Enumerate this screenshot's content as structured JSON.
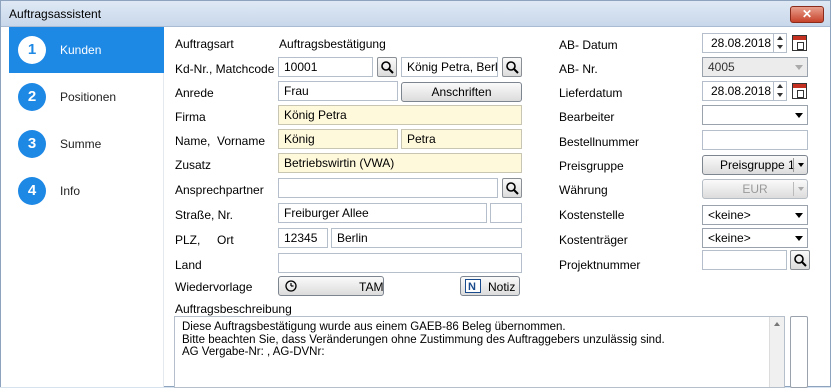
{
  "window": {
    "title": "Auftragsassistent",
    "close_label": "✕"
  },
  "sidebar": {
    "steps": [
      {
        "num": "1",
        "label": "Kunden"
      },
      {
        "num": "2",
        "label": "Positionen"
      },
      {
        "num": "3",
        "label": "Summe"
      },
      {
        "num": "4",
        "label": "Info"
      }
    ]
  },
  "form": {
    "auftragsart": {
      "label": "Auftragsart",
      "value": "Auftragsbestätigung"
    },
    "kdnr": {
      "label": "Kd-Nr.,  Matchcode",
      "value": "10001",
      "matchcode": "König Petra, Berlin"
    },
    "anrede": {
      "label": "Anrede",
      "value": "Frau",
      "button": "Anschriften"
    },
    "firma": {
      "label": "Firma",
      "value": "König Petra"
    },
    "name": {
      "label_name": "Name,",
      "label_vorname": "Vorname",
      "name": "König",
      "vorname": "Petra"
    },
    "zusatz": {
      "label": "Zusatz",
      "value": "Betriebswirtin (VWA)"
    },
    "ansprechpartner": {
      "label": "Ansprechpartner",
      "value": ""
    },
    "strasse": {
      "label": "Straße,  Nr.",
      "value": "Freiburger Allee",
      "nr": ""
    },
    "plz": {
      "label_plz": "PLZ,",
      "label_ort": "Ort",
      "plz": "12345",
      "ort": "Berlin"
    },
    "land": {
      "label": "Land",
      "value": ""
    },
    "wiedervorlage": {
      "label": "Wiedervorlage",
      "button": "TAM",
      "notiz": "Notiz"
    },
    "beschreibung": {
      "label": "Auftragsbeschreibung",
      "lines": [
        "Diese Auftragsbestätigung wurde aus einem GAEB-86 Beleg übernommen.",
        "Bitte beachten Sie, dass Veränderungen ohne Zustimmung des Auftraggebers unzulässig sind.",
        "AG Vergabe-Nr: ,   AG-DVNr:"
      ]
    }
  },
  "right": {
    "ab_datum": {
      "label": "AB- Datum",
      "value": "28.08.2018"
    },
    "ab_nr": {
      "label": "AB- Nr.",
      "value": "4005"
    },
    "lieferdatum": {
      "label": "Lieferdatum",
      "value": "28.08.2018"
    },
    "bearbeiter": {
      "label": "Bearbeiter",
      "value": ""
    },
    "bestellnummer": {
      "label": "Bestellnummer",
      "value": ""
    },
    "preisgruppe": {
      "label": "Preisgruppe",
      "value": "Preisgruppe 1"
    },
    "waehrung": {
      "label": "Währung",
      "value": "EUR"
    },
    "kostenstelle": {
      "label": "Kostenstelle",
      "value": "<keine>"
    },
    "kostentraeger": {
      "label": "Kostenträger",
      "value": "<keine>"
    },
    "projektnummer": {
      "label": "Projektnummer",
      "value": ""
    }
  }
}
